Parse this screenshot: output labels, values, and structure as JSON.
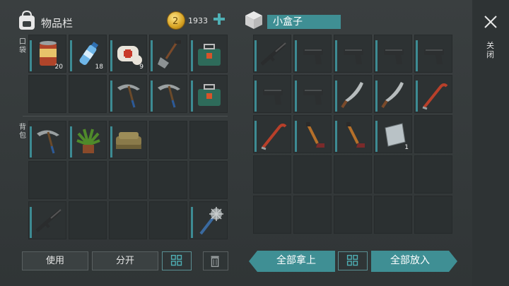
{
  "inventory": {
    "title": "物品栏",
    "currency_value": "1933",
    "pocket_label": "口袋",
    "backpack_label": "背包",
    "slots": [
      {
        "icon": "tin-can-icon",
        "qty": "20"
      },
      {
        "icon": "water-bottle-icon",
        "qty": "18"
      },
      {
        "icon": "bandage-icon",
        "qty": "9"
      },
      {
        "icon": "shovel-icon",
        "qty": ""
      },
      {
        "icon": "toolbox-icon",
        "qty": ""
      },
      {
        "icon": "",
        "qty": ""
      },
      {
        "icon": "",
        "qty": ""
      },
      {
        "icon": "pickaxe-icon",
        "qty": ""
      },
      {
        "icon": "pickaxe-icon",
        "qty": ""
      },
      {
        "icon": "toolbox-icon",
        "qty": ""
      },
      {
        "icon": "pickaxe-icon",
        "qty": ""
      },
      {
        "icon": "potted-plant-icon",
        "qty": ""
      },
      {
        "icon": "sofa-icon",
        "qty": ""
      },
      {
        "icon": "",
        "qty": ""
      },
      {
        "icon": "",
        "qty": ""
      },
      {
        "icon": "",
        "qty": ""
      },
      {
        "icon": "",
        "qty": ""
      },
      {
        "icon": "",
        "qty": ""
      },
      {
        "icon": "",
        "qty": ""
      },
      {
        "icon": "",
        "qty": ""
      },
      {
        "icon": "rifle-icon",
        "qty": ""
      },
      {
        "icon": "",
        "qty": ""
      },
      {
        "icon": "",
        "qty": ""
      },
      {
        "icon": "",
        "qty": ""
      },
      {
        "icon": "spiked-club-icon",
        "qty": ""
      }
    ]
  },
  "container": {
    "title": "小盒子",
    "slots": [
      {
        "icon": "rifle-icon",
        "qty": ""
      },
      {
        "icon": "pistol-icon",
        "qty": ""
      },
      {
        "icon": "pistol-icon",
        "qty": ""
      },
      {
        "icon": "pistol-icon",
        "qty": ""
      },
      {
        "icon": "pistol-icon",
        "qty": ""
      },
      {
        "icon": "pistol-icon",
        "qty": ""
      },
      {
        "icon": "pistol-icon",
        "qty": ""
      },
      {
        "icon": "machete-icon",
        "qty": ""
      },
      {
        "icon": "machete-icon",
        "qty": ""
      },
      {
        "icon": "crowbar-icon",
        "qty": ""
      },
      {
        "icon": "crowbar-icon",
        "qty": ""
      },
      {
        "icon": "hockey-stick-icon",
        "qty": ""
      },
      {
        "icon": "hockey-stick-icon",
        "qty": ""
      },
      {
        "icon": "metal-sheet-icon",
        "qty": "1"
      },
      {
        "icon": "",
        "qty": ""
      }
    ]
  },
  "actions": {
    "use_label": "使用",
    "split_label": "分开",
    "take_all_label": "全部拿上",
    "put_all_label": "全部放入",
    "close_label": "关闭"
  },
  "colors": {
    "accent": "#3f8f94",
    "background": "#34393a"
  }
}
